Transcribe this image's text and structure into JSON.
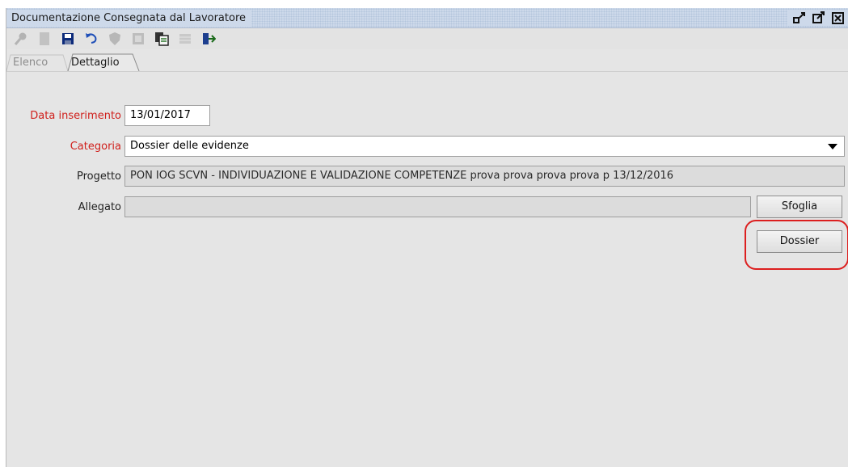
{
  "window": {
    "title": "Documentazione Consegnata dal Lavoratore",
    "controls": [
      "restore-icon",
      "maximize-icon",
      "close-icon"
    ]
  },
  "toolbar": {
    "buttons": [
      {
        "icon": "search-icon",
        "enabled": false
      },
      {
        "icon": "new-document-icon",
        "enabled": false
      },
      {
        "icon": "save-icon",
        "enabled": true
      },
      {
        "icon": "undo-icon",
        "enabled": true
      },
      {
        "icon": "shield-icon",
        "enabled": false
      },
      {
        "icon": "print-icon",
        "enabled": false
      },
      {
        "icon": "copy-icon",
        "enabled": true
      },
      {
        "icon": "grid-icon",
        "enabled": false
      },
      {
        "icon": "exit-icon",
        "enabled": true
      }
    ]
  },
  "tabs": [
    {
      "label": "Elenco",
      "active": false
    },
    {
      "label": "Dettaglio",
      "active": true
    }
  ],
  "form": {
    "data_inserimento": {
      "label": "Data inserimento",
      "value": "13/01/2017",
      "required": true
    },
    "categoria": {
      "label": "Categoria",
      "value": "Dossier delle evidenze",
      "required": true
    },
    "progetto": {
      "label": "Progetto",
      "value": "PON IOG SCVN - INDIVIDUAZIONE E VALIDAZIONE COMPETENZE prova prova prova prova p 13/12/2016",
      "required": false
    },
    "allegato": {
      "label": "Allegato",
      "value": "",
      "required": false
    }
  },
  "buttons": {
    "sfoglia": "Sfoglia",
    "dossier": "Dossier"
  },
  "colors": {
    "required_label": "#d0201c",
    "highlight": "#dc1f1f",
    "titlebar": "#cdd9ea"
  }
}
